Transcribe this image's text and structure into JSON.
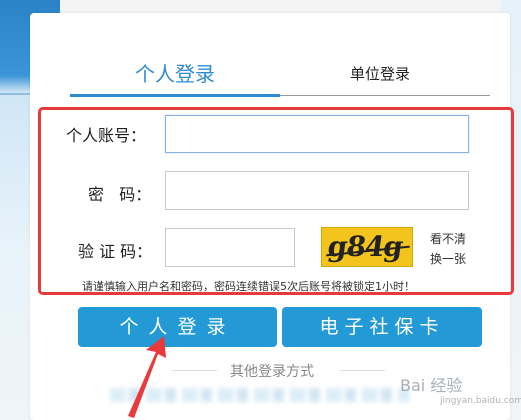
{
  "tabs": {
    "personal": "个人登录",
    "unit": "单位登录"
  },
  "form": {
    "account_label": "个人账号：",
    "password_label": "密   码：",
    "captcha_label": "验 证 码：",
    "account_value": "",
    "password_value": "",
    "captcha_value": "",
    "captcha_image_text": "g84g",
    "refresh_line1": "看不清",
    "refresh_line2": "换一张",
    "notice": "请谨慎输入用户名和密码，密码连续错误5次后账号将被锁定1小时！"
  },
  "buttons": {
    "personal_login": "个人登录",
    "social_card": "电子社保卡"
  },
  "other_login": "其他登录方式",
  "watermark": {
    "text": "Bai 经验",
    "sub": "jingyan.baidu.com"
  },
  "colors": {
    "accent": "#2d8cd1",
    "button": "#239ad6",
    "annotation": "#e8393b",
    "captcha_bg": "#f3c31e"
  }
}
